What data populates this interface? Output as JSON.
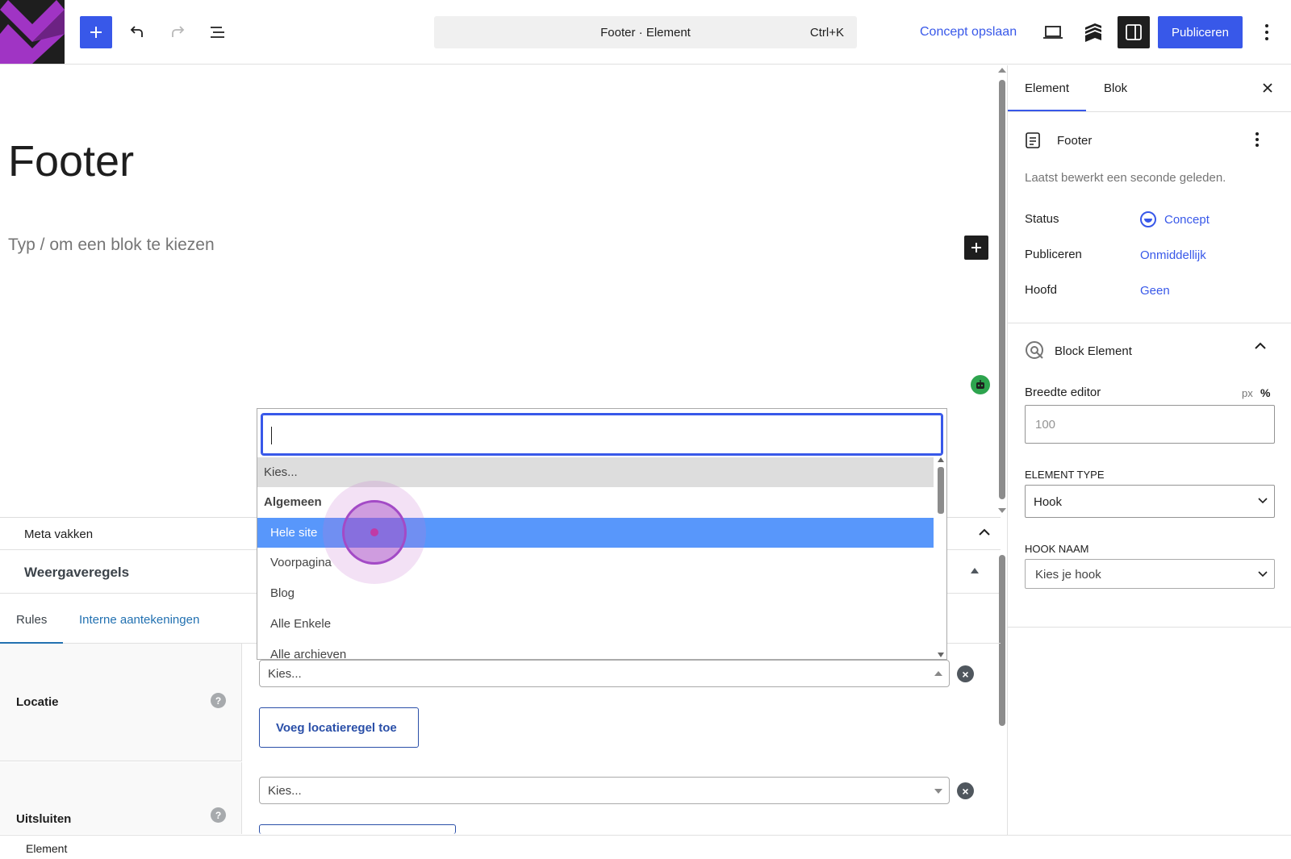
{
  "topbar": {
    "command_title": "Footer · Element",
    "command_shortcut": "Ctrl+K",
    "save_draft": "Concept opslaan",
    "publish": "Publiceren",
    "accent": "#3858e9"
  },
  "editor": {
    "title": "Footer",
    "placeholder": "Typ / om een blok te kiezen"
  },
  "meta": {
    "section_label": "Meta vakken",
    "panel_title": "Weergaveregels",
    "tabs": [
      "Rules",
      "Interne aantekeningen"
    ],
    "location_label": "Locatie",
    "location_select": "Kies...",
    "add_location_rule": "Voeg locatieregel toe",
    "exclude_label": "Uitsluiten",
    "exclude_select": "Kies..."
  },
  "dropdown": {
    "search_value": "",
    "options": [
      {
        "label": "Kies...",
        "kind": "option",
        "state": "hovered"
      },
      {
        "label": "Algemeen",
        "kind": "group"
      },
      {
        "label": "Hele site",
        "kind": "option",
        "state": "selected"
      },
      {
        "label": "Voorpagina",
        "kind": "option"
      },
      {
        "label": "Blog",
        "kind": "option"
      },
      {
        "label": "Alle Enkele",
        "kind": "option"
      },
      {
        "label": "Alle archieven",
        "kind": "option"
      }
    ]
  },
  "sidebar": {
    "tabs": [
      "Element",
      "Blok"
    ],
    "post_name": "Footer",
    "last_edited": "Laatst bewerkt een seconde geleden.",
    "status_label": "Status",
    "status_value": "Concept",
    "publish_label": "Publiceren",
    "publish_value": "Onmiddellijk",
    "parent_label": "Hoofd",
    "parent_value": "Geen",
    "block_element_title": "Block Element",
    "editor_width_label": "Breedte editor",
    "unit_px": "px",
    "unit_pct": "%",
    "editor_width_placeholder": "100",
    "element_type_label": "ELEMENT TYPE",
    "element_type_value": "Hook",
    "hook_name_label": "HOOK NAAM",
    "hook_name_value": "Kies je hook"
  },
  "footer": {
    "breadcrumb": "Element"
  }
}
